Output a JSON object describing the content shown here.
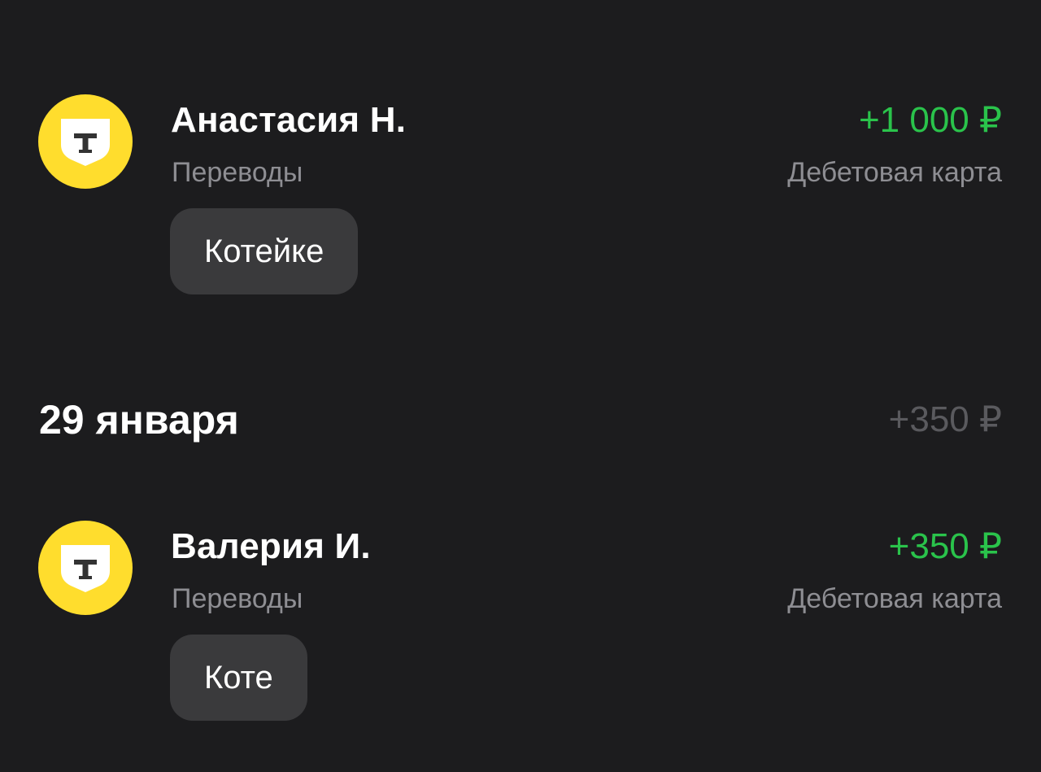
{
  "operations": [
    {
      "merchant": "Анастасия Н.",
      "category": "Переводы",
      "amount": "+1 000 ₽",
      "account": "Дебетовая карта",
      "comment": "Котейке",
      "logo_icon": "tbank-shield-icon"
    },
    {
      "merchant": "Валерия И.",
      "category": "Переводы",
      "amount": "+350 ₽",
      "account": "Дебетовая карта",
      "comment": "Коте",
      "logo_icon": "tbank-shield-icon"
    }
  ],
  "date_group": {
    "date": "29 января",
    "total": "+350 ₽"
  },
  "colors": {
    "background": "#1c1c1e",
    "income": "#2ac34b",
    "secondary_text": "#8e8e93",
    "chip": "#3a3a3c",
    "brand_yellow": "#ffdd2d"
  }
}
